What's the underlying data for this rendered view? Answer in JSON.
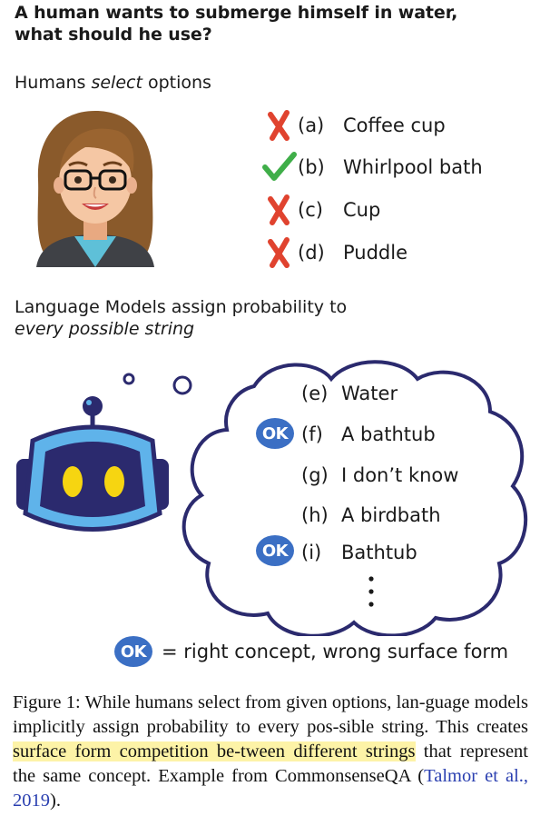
{
  "question": {
    "line1": "A human wants to submerge himself in water,",
    "line2": "what should he use?"
  },
  "humans": {
    "label_pre": "Humans ",
    "label_em": "select",
    "label_post": " options",
    "options": [
      {
        "letter": "(a)",
        "text": "Coffee cup",
        "mark": "cross-icon"
      },
      {
        "letter": "(b)",
        "text": "Whirlpool bath",
        "mark": "check-icon"
      },
      {
        "letter": "(c)",
        "text": "Cup",
        "mark": "cross-icon"
      },
      {
        "letter": "(d)",
        "text": "Puddle",
        "mark": "cross-icon"
      }
    ]
  },
  "lm": {
    "label_line1": "Language Models assign probability to",
    "label_line2": "every possible string",
    "options": [
      {
        "letter": "(e)",
        "text": "Water",
        "ok": false
      },
      {
        "letter": "(f)",
        "text": "A bathtub",
        "ok": true
      },
      {
        "letter": "(g)",
        "text": "I don’t know",
        "ok": false
      },
      {
        "letter": "(h)",
        "text": "A birdbath",
        "ok": false
      },
      {
        "letter": "(i)",
        "text": "Bathtub",
        "ok": true
      }
    ]
  },
  "legend": {
    "badge": "OK",
    "text": "= right concept, wrong surface form"
  },
  "caption": {
    "p1": "Figure 1: While humans select from given options, lan-guage models implicitly assign probability to every pos-sible string. This creates ",
    "highlight": "surface form competition be-tween different strings",
    "p2": " that represent the same concept. Example from CommonsenseQA (",
    "cite": "Talmor et al., 2019",
    "p3": ")."
  },
  "colors": {
    "cross": "#e0432f",
    "check": "#3fae49",
    "ok_badge": "#3b6fc4",
    "robot_outline": "#2b2a6e",
    "robot_light": "#5fb3ea",
    "highlight": "#fdf3a7",
    "citation": "#2a3fb0"
  }
}
